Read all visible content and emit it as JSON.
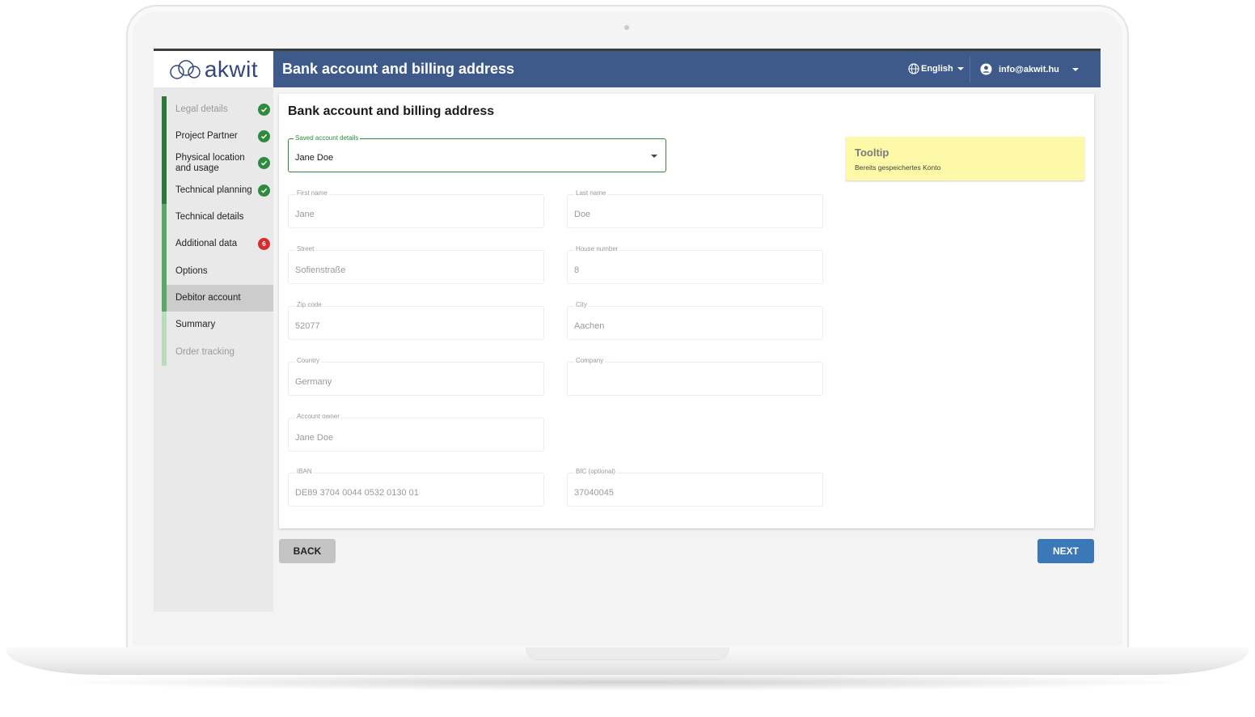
{
  "app": {
    "logo_text": "akwit"
  },
  "header": {
    "title": "Bank account and billing address",
    "language": "English",
    "user_email": "info@akwit.hu"
  },
  "sidebar": {
    "items": [
      {
        "label": "Legal details",
        "status": "complete",
        "muted": true
      },
      {
        "label": "Project Partner",
        "status": "complete"
      },
      {
        "label": "Physical location and usage",
        "status": "complete"
      },
      {
        "label": "Technical planning",
        "status": "complete"
      },
      {
        "label": "Technical details",
        "status": "none"
      },
      {
        "label": "Additional data",
        "status": "error",
        "badge": "6"
      },
      {
        "label": "Options",
        "status": "none"
      },
      {
        "label": "Debitor account",
        "status": "active"
      },
      {
        "label": "Summary",
        "status": "none"
      },
      {
        "label": "Order tracking",
        "status": "none",
        "muted": true
      }
    ]
  },
  "form": {
    "title": "Bank account and billing address",
    "saved_account": {
      "label": "Saved account details",
      "value": "Jane Doe"
    },
    "first_name": {
      "label": "First name",
      "value": "Jane"
    },
    "last_name": {
      "label": "Last name",
      "value": "Doe"
    },
    "street": {
      "label": "Street",
      "value": "Sofienstraße"
    },
    "house_number": {
      "label": "House number",
      "value": "8"
    },
    "zip": {
      "label": "Zip code",
      "value": "52077"
    },
    "city": {
      "label": "City",
      "value": "Aachen"
    },
    "country": {
      "label": "Country",
      "value": "Germany"
    },
    "company": {
      "label": "Company",
      "value": ""
    },
    "account_owner": {
      "label": "Account owner",
      "value": "Jane Doe"
    },
    "iban": {
      "label": "IBAN",
      "value": "DE89 3704 0044 0532 0130 01"
    },
    "bic": {
      "label": "BIC (optional)",
      "value": "37040045"
    }
  },
  "tooltip": {
    "title": "Tooltip",
    "text": "Bereits gespeichertes Konto"
  },
  "buttons": {
    "back": "BACK",
    "next": "NEXT"
  },
  "colors": {
    "header_bg": "#3e5a8a",
    "success": "#2e8b3e",
    "error": "#d32f2f",
    "primary_button": "#3b78b8",
    "tooltip_bg": "#fdf9a8"
  }
}
